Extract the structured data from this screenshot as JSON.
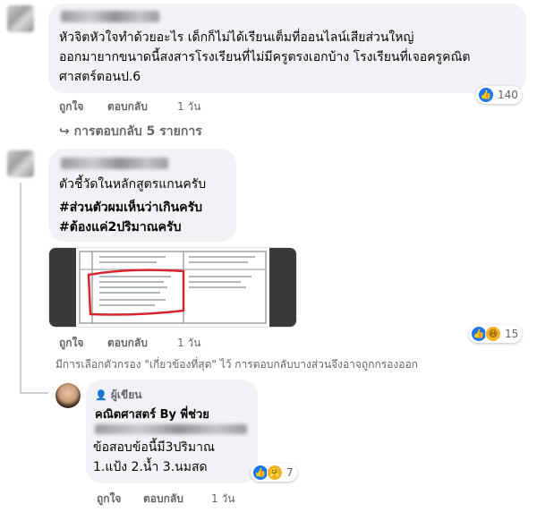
{
  "comments": [
    {
      "text_lines": [
        "หัวจิตหัวใจทำด้วยอะไร เด็กก็ไม่ได้เรียนเต็มที่ออนไลน์เสียส่วนใหญ่",
        "ออกมายากขนาดนี้สงสารโรงเรียนที่ไม่มีครูตรงเอกบ้าง โรงเรียนที่เจอครูคณิต",
        "ศาสตร์ตอนป.6"
      ],
      "actions": {
        "like": "ถูกใจ",
        "reply": "ตอบกลับ",
        "time": "1 วัน"
      },
      "reactions": {
        "icons": [
          "like-icon"
        ],
        "count": "140"
      },
      "view_replies": "การตอบกลับ 5 รายการ"
    },
    {
      "text": "ตัวชี้วัดในหลักสูตรแกนครับ",
      "hashtags": [
        "#ส่วนตัวผมเห็นว่าเกินครับ",
        "#ต้องแค่2ปริมาณครับ"
      ],
      "actions": {
        "like": "ถูกใจ",
        "reply": "ตอบกลับ",
        "time": "1 วัน"
      },
      "reactions": {
        "icons": [
          "like-icon",
          "haha-icon"
        ],
        "count": "15"
      },
      "filter_note": "มีการเลือกตัวกรอง \"เกี่ยวข้องที่สุด\" ไว้ การตอบกลับบางส่วนจึงอาจถูกกรองออก"
    },
    {
      "author_badge": "ผู้เขียน",
      "author": "คณิตศาสตร์ By พี่ช่วย",
      "text_lines": [
        "ข้อสอบข้อนี้มี3ปริมาณ",
        "1.แป้ง 2.น้ำ 3.นมสด"
      ],
      "actions": {
        "like": "ถูกใจ",
        "reply": "ตอบกลับ",
        "time": "1 วัน"
      },
      "reactions": {
        "icons": [
          "like-icon",
          "care-icon"
        ],
        "count": "7"
      }
    }
  ],
  "colors": {
    "bubble": "#f0f2f5",
    "secondary_text": "#65676b",
    "like_blue": "#1877f2",
    "annotation_red": "#d9262e"
  }
}
